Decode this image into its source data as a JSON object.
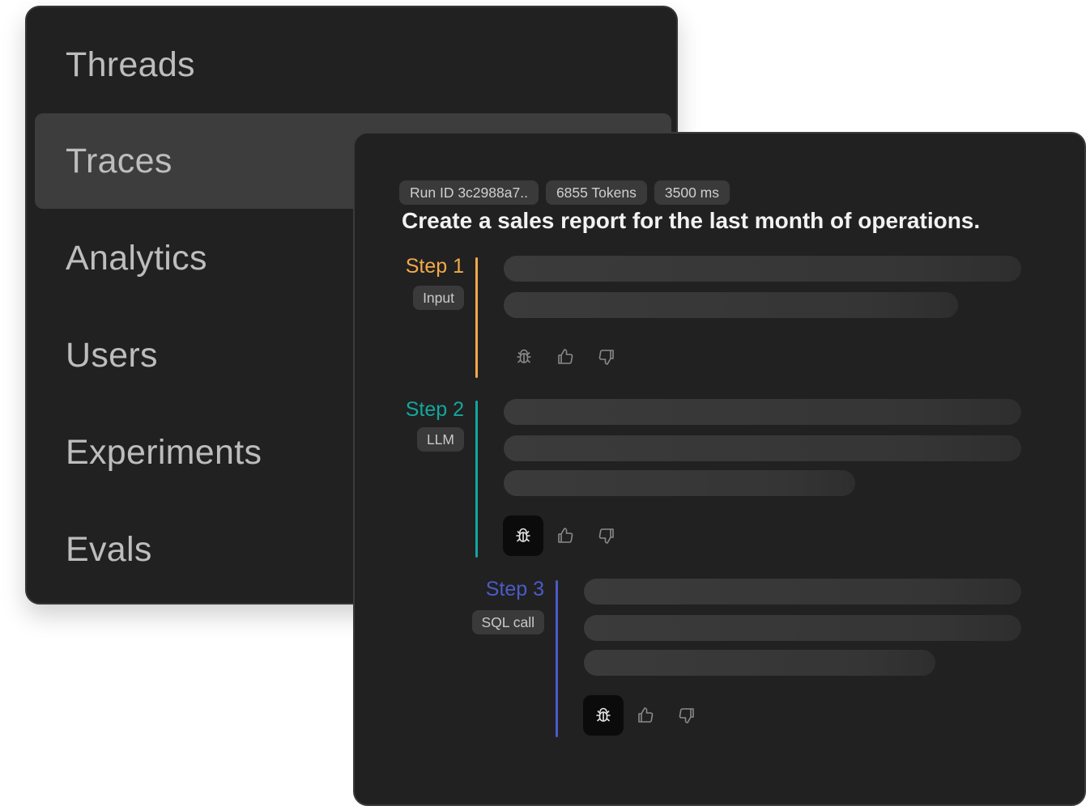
{
  "nav": {
    "items": [
      {
        "label": "Threads",
        "active": false
      },
      {
        "label": "Traces",
        "active": true
      },
      {
        "label": "Analytics",
        "active": false
      },
      {
        "label": "Users",
        "active": false
      },
      {
        "label": "Experiments",
        "active": false
      },
      {
        "label": "Evals",
        "active": false
      }
    ]
  },
  "run": {
    "run_id_label": "Run ID 3c2988a7..",
    "tokens_label": "6855 Tokens",
    "duration_label": "3500 ms",
    "title": "Create a sales report for the last month of operations."
  },
  "steps": [
    {
      "name": "Step 1",
      "type": "Input",
      "color": "#f2a94a",
      "icons": [
        "bug-icon",
        "thumbs-up-icon",
        "thumbs-down-icon"
      ]
    },
    {
      "name": "Step 2",
      "type": "LLM",
      "color": "#14a79c",
      "icons": [
        "bug-icon",
        "thumbs-up-icon",
        "thumbs-down-icon"
      ]
    },
    {
      "name": "Step 3",
      "type": "SQL call",
      "color": "#4b5bc8",
      "icons": [
        "bug-icon",
        "thumbs-up-icon",
        "thumbs-down-icon"
      ]
    }
  ],
  "colors": {
    "panel_bg": "#212121",
    "active_item_bg": "#3d3d3d",
    "chip_bg": "#3a3a3a"
  }
}
